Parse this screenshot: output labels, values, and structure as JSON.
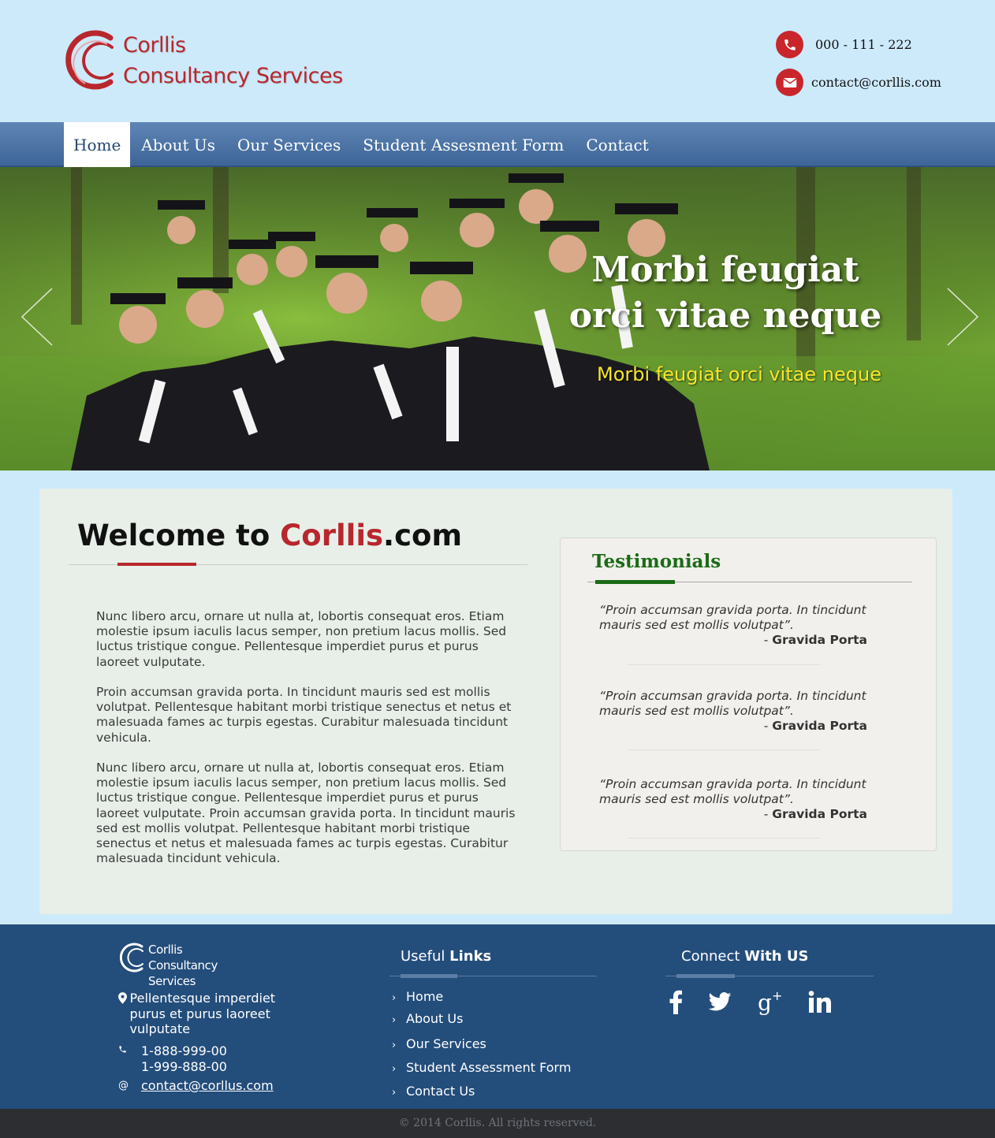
{
  "header": {
    "logo_line1": "Corllis",
    "logo_line2": "Consultancy Services",
    "phone": "000 - 111 - 222",
    "email": "contact@corllis.com"
  },
  "nav": {
    "items": [
      "Home",
      "About Us",
      "Our Services",
      "Student Assesment Form",
      "Contact"
    ],
    "active": "Home"
  },
  "hero": {
    "title": "Morbi feugiat orci vitae neque",
    "subtitle": "Morbi feugiat orci vitae neque"
  },
  "welcome": {
    "title_prefix": "Welcome to ",
    "title_brand": "Corllis",
    "title_suffix": ".com",
    "paragraphs": [
      "Nunc libero arcu, ornare ut nulla at, lobortis consequat eros. Etiam molestie ipsum iaculis lacus semper, non pretium lacus mollis. Sed luctus tristique congue. Pellentesque imperdiet purus et purus laoreet vulputate.",
      "Proin accumsan gravida porta. In tincidunt mauris sed est mollis volutpat. Pellentesque habitant morbi tristique senectus et netus et malesuada fames ac turpis egestas. Curabitur malesuada tincidunt vehicula.",
      "Nunc libero arcu, ornare ut nulla at, lobortis consequat eros. Etiam molestie ipsum iaculis lacus semper, non pretium lacus mollis. Sed luctus tristique congue. Pellentesque imperdiet purus et purus laoreet vulputate. Proin accumsan gravida porta. In tincidunt mauris sed est mollis volutpat. Pellentesque habitant morbi tristique senectus et netus et malesuada fames ac turpis egestas. Curabitur malesuada tincidunt vehicula."
    ]
  },
  "testimonials": {
    "title": "Testimonials",
    "items": [
      {
        "quote": "“Proin accumsan gravida porta. In tincidunt mauris sed est mollis volutpat”.",
        "author": "Gravida Porta"
      },
      {
        "quote": "“Proin accumsan gravida porta. In tincidunt mauris sed est mollis volutpat”.",
        "author": "Gravida Porta"
      },
      {
        "quote": "“Proin accumsan gravida porta. In tincidunt mauris sed est mollis volutpat”.",
        "author": "Gravida Porta"
      }
    ]
  },
  "footer": {
    "logo_line1": "Corllis",
    "logo_line2": "Consultancy Services",
    "address": "Pellentesque imperdiet purus et purus laoreet vulputate",
    "phone1": "1-888-999-00",
    "phone2": "1-999-888-00",
    "email": "contact@corllus.com",
    "links_head_light": "Useful ",
    "links_head_bold": "Links",
    "links": [
      "Home",
      "About Us",
      "Our Services",
      "Student Assessment Form",
      "Contact Us"
    ],
    "connect_head_light": "Connect ",
    "connect_head_bold": "With US",
    "social": [
      "facebook-icon",
      "twitter-icon",
      "google-plus-icon",
      "linkedin-icon"
    ]
  },
  "copyright": "© 2014 Corllis. All rights reserved.",
  "colors": {
    "brand_red": "#b8272c",
    "nav_blue": "#4a71a2",
    "footer_blue": "#234d7b",
    "testimonial_green": "#1a6b16",
    "hero_subtitle_yellow": "#f7e52a"
  }
}
